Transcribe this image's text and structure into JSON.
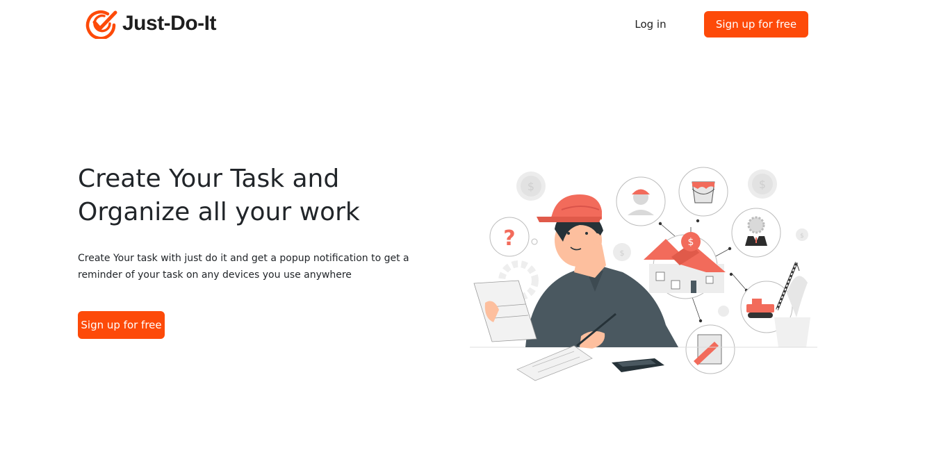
{
  "navbar": {
    "brand_name": "Just-Do-It",
    "login_label": "Log in",
    "signup_label": "Sign up for free"
  },
  "hero": {
    "title_lines": [
      "Create Your Task and",
      "Organize all your work"
    ],
    "description_lines": [
      "Create Your task with just do it and get a popup notification to get a",
      "reminder of your task on any devices you use anywhere"
    ],
    "cta_label": "Sign up for free"
  },
  "illustration": {
    "question_mark": "?",
    "dollar_sign": "$"
  },
  "colors": {
    "accent": "#fd4a09",
    "illustration_accent": "#f26b5b",
    "text_dark": "#212529",
    "shirt": "#4a5860"
  },
  "icons": [
    "check-circle-logo-icon",
    "dollar-coin-icon",
    "question-mark-icon",
    "worker-avatar-icon",
    "paint-bucket-icon",
    "businessman-gear-icon",
    "house-icon",
    "crane-icon",
    "pencil-paper-icon",
    "calculator-icon",
    "plant-icon"
  ]
}
